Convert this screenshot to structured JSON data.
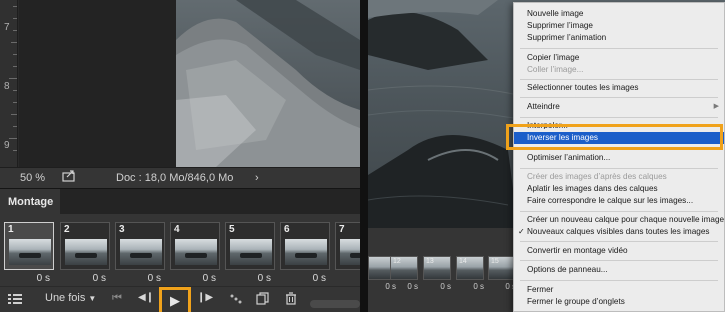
{
  "ruler": {
    "numbers": [
      "7",
      "8",
      "9"
    ]
  },
  "status": {
    "zoom": "50 %",
    "doc_info": "Doc : 18,0 Mo/846,0 Mo",
    "arrow": "›"
  },
  "panel": {
    "tab_label": "Montage"
  },
  "frames": [
    {
      "num": "1",
      "time": "0 s"
    },
    {
      "num": "2",
      "time": "0 s"
    },
    {
      "num": "3",
      "time": "0 s"
    },
    {
      "num": "4",
      "time": "0 s"
    },
    {
      "num": "5",
      "time": "0 s"
    },
    {
      "num": "6",
      "time": "0 s"
    },
    {
      "num": "7",
      "time": "0 s"
    }
  ],
  "controls": {
    "loop_label": "Une fois",
    "first_frame": "⏮",
    "prev_frame": "◀❙",
    "play": "▶",
    "next_frame": "❙▶"
  },
  "right_frames": [
    {
      "num": "12",
      "time": "0 s"
    },
    {
      "num": "13",
      "time": "0 s"
    },
    {
      "num": "14",
      "time": "0 s"
    },
    {
      "num": "15",
      "time": "0 s"
    },
    {
      "num": "16",
      "time": "0 s"
    }
  ],
  "menu": {
    "items": [
      {
        "label": "Nouvelle image",
        "disabled": false
      },
      {
        "label": "Supprimer l’image",
        "disabled": false
      },
      {
        "label": "Supprimer l’animation",
        "disabled": false
      },
      {
        "label": "Copier l’image",
        "disabled": false
      },
      {
        "label": "Coller l’image...",
        "disabled": true
      },
      {
        "label": "Sélectionner toutes les images",
        "disabled": false
      },
      {
        "label": "Atteindre",
        "disabled": false,
        "submenu": true
      },
      {
        "label": "Interpoler...",
        "disabled": false
      },
      {
        "label": "Inverser les images",
        "disabled": false,
        "highlighted": true
      },
      {
        "label": "Optimiser l’animation...",
        "disabled": false
      },
      {
        "label": "Créer des images d’après des calques",
        "disabled": true
      },
      {
        "label": "Aplatir les images dans des calques",
        "disabled": false
      },
      {
        "label": "Faire correspondre le calque sur les images...",
        "disabled": false
      },
      {
        "label": "Créer un nouveau calque pour chaque nouvelle image",
        "disabled": false
      },
      {
        "label": "Nouveaux calques visibles dans toutes les images",
        "disabled": false,
        "checked": true
      },
      {
        "label": "Convertir en montage vidéo",
        "disabled": false
      },
      {
        "label": "Options de panneau...",
        "disabled": false
      },
      {
        "label": "Fermer",
        "disabled": false
      },
      {
        "label": "Fermer le groupe d’onglets",
        "disabled": false
      }
    ],
    "checkmark": "✓",
    "submenu_arrow": "▶"
  },
  "colors": {
    "accent_highlight": "#f0a21b",
    "menu_selection": "#1b5ec9"
  }
}
